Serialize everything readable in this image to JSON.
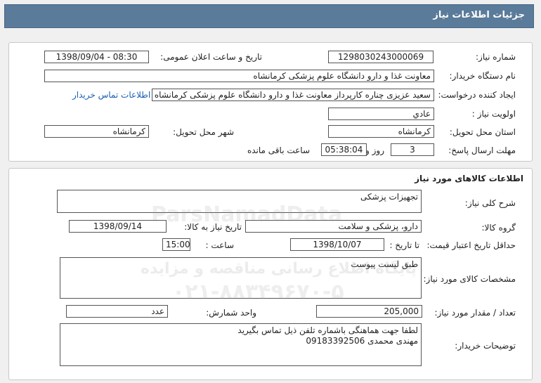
{
  "header": {
    "title": "جزئیات اطلاعات نیاز"
  },
  "details": {
    "need_number_label": "شماره نیاز:",
    "need_number": "1298030243000069",
    "announce_label": "تاریخ و ساعت اعلان عمومی:",
    "announce_value": "1398/09/04 - 08:30",
    "buyer_org_label": "نام دستگاه خریدار:",
    "buyer_org": "معاونت غذا و دارو دانشگاه علوم پزشکی کرمانشاه",
    "creator_label": "ایجاد کننده درخواست:",
    "creator": "سعید عزیزی چناره کارپرداز معاونت غذا و دارو دانشگاه علوم پزشکی کرمانشاه",
    "contact_link": "اطلاعات تماس خریدار",
    "priority_label": "اولویت نیاز :",
    "priority": "عادي",
    "province_label": "استان محل تحویل:",
    "province": "کرمانشاه",
    "city_label": "شهر محل تحویل:",
    "city": "کرمانشاه",
    "deadline_label": "مهلت ارسال پاسخ:",
    "days": "3",
    "days_label": "روز و",
    "time_left": "05:38:04",
    "remaining_label": "ساعت باقی مانده"
  },
  "goods": {
    "section_title": "اطلاعات کالاهای مورد نیاز",
    "general_desc_label": "شرح کلی نیاز:",
    "general_desc": "تجهیزات پزشکی",
    "group_label": "گروه کالا:",
    "group": "دارو، پزشکی و سلامت",
    "need_date_label": "تاریخ نیاز به کالا:",
    "need_date": "1398/09/14",
    "min_price_label": "حداقل تاریخ اعتبار قیمت:",
    "until_date_label": "تا تاریخ :",
    "until_date": "1398/10/07",
    "time_label": "ساعت :",
    "time": "15:00",
    "spec_label": "مشخصات کالای مورد نیاز:",
    "spec": "طبق لیست پیوست",
    "qty_label": "تعداد / مقدار مورد نیاز:",
    "qty": "205,000",
    "unit_label": "واحد شمارش:",
    "unit": "عدد",
    "buyer_notes_label": "توضیحات خریدار:",
    "buyer_notes": "لطفا جهت هماهنگی باشماره تلفن ذیل تماس بگیرید\nمهندی محمدی      09183392506"
  },
  "watermark": {
    "brand": "ParsNamadData",
    "tagline": "پایگاه اطلاع رسانی مناقصه و مزایده",
    "phone": "۰۲۱-۸۸۳۴۹۶۷۰-۵"
  },
  "colors": {
    "header_bg": "#5a7b9a",
    "link": "#1a5fb4"
  }
}
